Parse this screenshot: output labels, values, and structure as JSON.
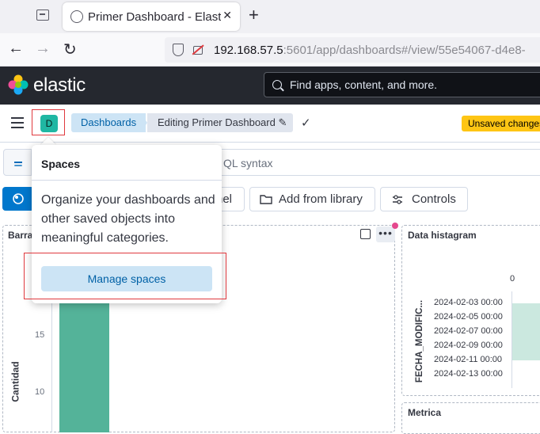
{
  "browser": {
    "tab_title": "Primer Dashboard - Elastic",
    "tab_close": "✕",
    "new_tab": "+",
    "url_host": "192.168.57.5",
    "url_rest": ":5601/app/dashboards#/view/55e54067-d4e8-",
    "nav_back": "←",
    "nav_forward": "→",
    "nav_reload": "↻"
  },
  "header": {
    "logo_text": "elastic",
    "search_placeholder": "Find apps, content, and more."
  },
  "subbar": {
    "space_initial": "D",
    "breadcrumb_dashboards": "Dashboards",
    "breadcrumb_editing": "Editing Primer Dashboard ✎",
    "check": "✓",
    "unsaved_badge": "Unsaved changes"
  },
  "query": {
    "hint": "QL syntax"
  },
  "toolbar": {
    "panel_label": "nel",
    "add_from_library": "Add from library",
    "controls": "Controls"
  },
  "panels": {
    "bar": {
      "title": "Barra",
      "ylabel": "Cantidad",
      "tick_15": "15",
      "tick_10": "10",
      "more": "•••"
    },
    "histogram": {
      "title": "Data histagram",
      "zero": "0",
      "ylabel": "FECHA_MODIFIC...",
      "dates": [
        "2024-02-03 00:00",
        "2024-02-05 00:00",
        "2024-02-07 00:00",
        "2024-02-09 00:00",
        "2024-02-11 00:00",
        "2024-02-13 00:00"
      ]
    },
    "metric": {
      "title": "Metrica"
    }
  },
  "popover": {
    "title": "Spaces",
    "description": "Organize your dashboards and other saved objects into meaningful categories.",
    "manage_button": "Manage spaces"
  },
  "colors": {
    "accent": "#0077cc",
    "space_avatar": "#20b7a3",
    "bar": "#54b399",
    "highlight_outline": "#e0393e",
    "unsaved": "#fec514"
  }
}
